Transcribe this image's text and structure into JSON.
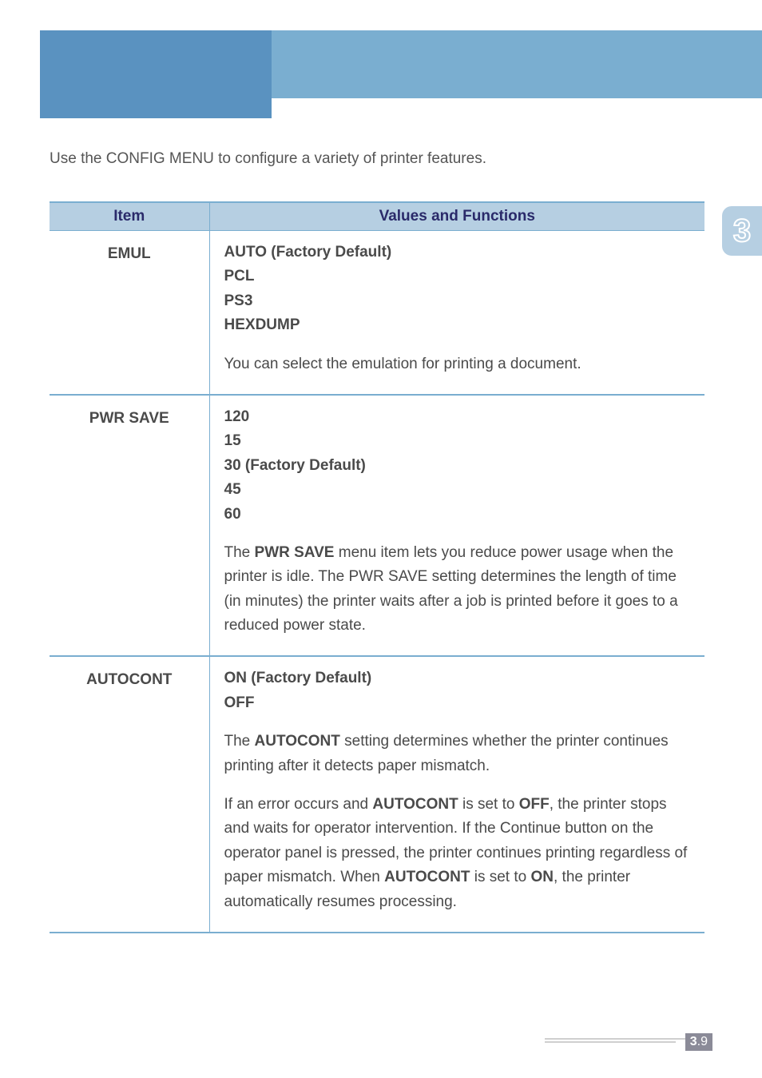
{
  "intro": "Use the CONFIG MENU to configure a variety of printer features.",
  "table": {
    "headers": {
      "item": "Item",
      "values": "Values and Functions"
    },
    "rows": [
      {
        "item": "EMUL",
        "defaults": [
          "AUTO (Factory Default)",
          "PCL",
          "PS3",
          "HEXDUMP"
        ],
        "desc": "You can select the emulation for printing a document."
      },
      {
        "item": "PWR SAVE",
        "defaults": [
          "120",
          "15",
          "30 (Factory Default)",
          "45",
          "60"
        ],
        "desc_pre": "The ",
        "desc_b1": "PWR SAVE",
        "desc_post": " menu item lets you reduce power usage when the printer is idle. The PWR SAVE setting determines the length of time (in minutes) the printer waits after a job is printed before it goes to a reduced power state."
      },
      {
        "item": "AUTOCONT",
        "defaults": [
          "ON (Factory Default)",
          "OFF"
        ],
        "p1_pre": "The ",
        "p1_b1": "AUTOCONT",
        "p1_post": " setting determines whether the printer continues printing after it detects paper mismatch.",
        "p2_pre": "If an error occurs and ",
        "p2_b1": "AUTOCONT",
        "p2_mid1": " is set to ",
        "p2_b2": "OFF",
        "p2_mid2": ", the printer stops and waits for operator intervention. If the Continue button on the operator panel is pressed, the printer continues printing regardless of paper mismatch. When ",
        "p2_b3": "AUTOCONT",
        "p2_mid3": " is set to ",
        "p2_b4": "ON",
        "p2_post": ", the printer automatically resumes processing."
      }
    ]
  },
  "chapter_badge": "3",
  "page": {
    "chapter": "3",
    "num": ".9"
  }
}
